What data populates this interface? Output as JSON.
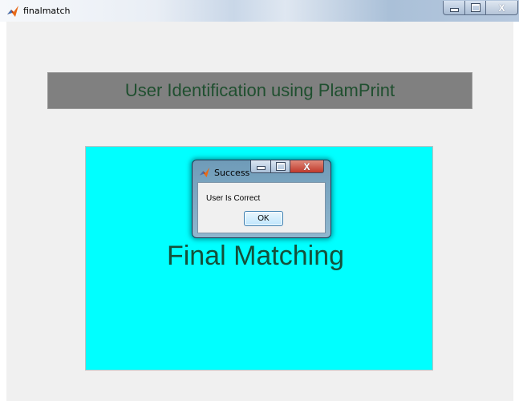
{
  "window": {
    "title": "finalmatch",
    "icon": "matlab-icon"
  },
  "heading": {
    "text": "User Identification using PlamPrint"
  },
  "panel": {
    "caption": "Final Matching",
    "color": "#00ffff"
  },
  "dialog": {
    "title": "Success",
    "message": "User Is Correct",
    "ok_label": "OK",
    "close_glyph": "X"
  },
  "colors": {
    "heading_bg": "#808080",
    "heading_text": "#1f4f2f",
    "caption_text": "#15503a"
  }
}
